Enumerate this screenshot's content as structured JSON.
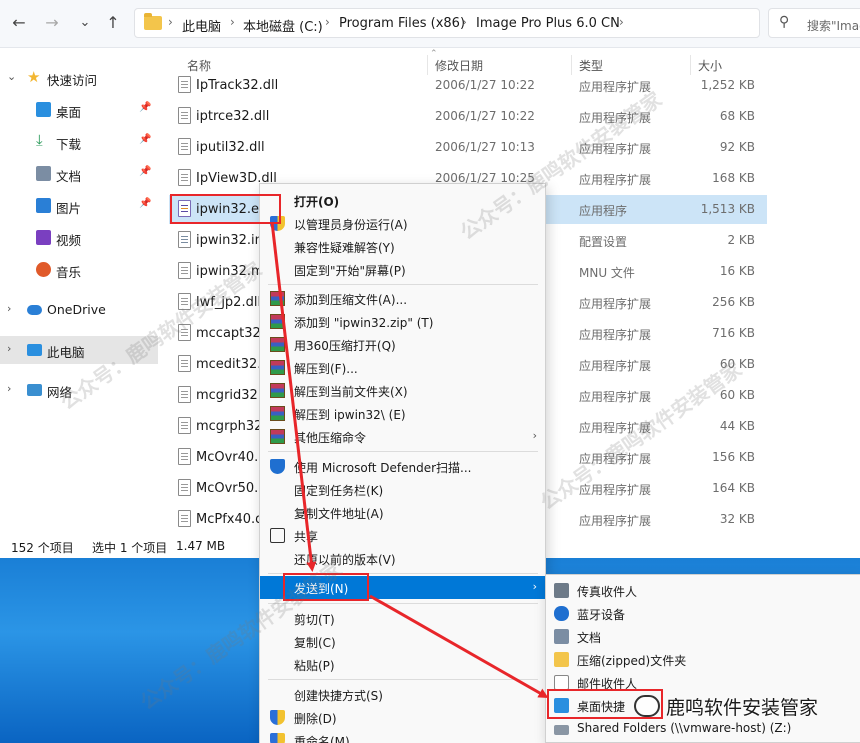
{
  "toolbar": {
    "back_icon": "←",
    "forward_icon": "→",
    "recent_icon": "⌄",
    "up_icon": "↑",
    "breadcrumb": [
      "此电脑",
      "本地磁盘 (C:)",
      "Program Files (x86)",
      "Image Pro Plus 6.0 CN"
    ],
    "search_placeholder": "搜索\"Imag"
  },
  "sidebar": {
    "items": [
      {
        "label": "快速访问",
        "icon": "star-icon"
      },
      {
        "label": "桌面",
        "icon": "desktop-icon"
      },
      {
        "label": "下载",
        "icon": "download-icon"
      },
      {
        "label": "文档",
        "icon": "document-icon"
      },
      {
        "label": "图片",
        "icon": "picture-icon"
      },
      {
        "label": "视频",
        "icon": "video-icon"
      },
      {
        "label": "音乐",
        "icon": "music-icon"
      },
      {
        "label": "OneDrive",
        "icon": "cloud-icon"
      },
      {
        "label": "此电脑",
        "icon": "computer-icon"
      },
      {
        "label": "网络",
        "icon": "network-icon"
      }
    ]
  },
  "columns": {
    "name": "名称",
    "date": "修改日期",
    "type": "类型",
    "size": "大小"
  },
  "files": [
    {
      "name": "IpTrack32.dll",
      "date": "2006/1/27 10:22",
      "type": "应用程序扩展",
      "size": "1,252 KB"
    },
    {
      "name": "iptrce32.dll",
      "date": "2006/1/27 10:22",
      "type": "应用程序扩展",
      "size": "68 KB"
    },
    {
      "name": "iputil32.dll",
      "date": "2006/1/27 10:13",
      "type": "应用程序扩展",
      "size": "92 KB"
    },
    {
      "name": "IpView3D.dll",
      "date": "2006/1/27 10:25",
      "type": "应用程序扩展",
      "size": "168 KB"
    },
    {
      "name": "ipwin32.exe",
      "date": "",
      "type": "应用程序",
      "size": "1,513 KB"
    },
    {
      "name": "ipwin32.ini",
      "date": "",
      "type": "配置设置",
      "size": "2 KB"
    },
    {
      "name": "ipwin32.mn",
      "date": "",
      "type": "MNU 文件",
      "size": "16 KB"
    },
    {
      "name": "lwf_jp2.dll",
      "date": "",
      "type": "应用程序扩展",
      "size": "256 KB"
    },
    {
      "name": "mccapt32.c",
      "date": "",
      "type": "应用程序扩展",
      "size": "716 KB"
    },
    {
      "name": "mcedit32.d",
      "date": "",
      "type": "应用程序扩展",
      "size": "60 KB"
    },
    {
      "name": "mcgrid32.d",
      "date": "",
      "type": "应用程序扩展",
      "size": "60 KB"
    },
    {
      "name": "mcgrph32.c",
      "date": "",
      "type": "应用程序扩展",
      "size": "44 KB"
    },
    {
      "name": "McOvr40.d",
      "date": "",
      "type": "应用程序扩展",
      "size": "156 KB"
    },
    {
      "name": "McOvr50.d",
      "date": "",
      "type": "应用程序扩展",
      "size": "164 KB"
    },
    {
      "name": "McPfx40.dl",
      "date": "",
      "type": "应用程序扩展",
      "size": "32 KB"
    }
  ],
  "status": {
    "count": "152 个项目",
    "selected": "选中 1 个项目",
    "size": "1.47 MB"
  },
  "context_menu": {
    "items": [
      {
        "label": "打开(O)",
        "icon": "",
        "bold": true
      },
      {
        "label": "以管理员身份运行(A)",
        "icon": "shield-icon"
      },
      {
        "label": "兼容性疑难解答(Y)",
        "icon": ""
      },
      {
        "label": "固定到\"开始\"屏幕(P)",
        "icon": ""
      },
      {
        "label": "添加到压缩文件(A)...",
        "icon": "rar-icon"
      },
      {
        "label": "添加到 \"ipwin32.zip\" (T)",
        "icon": "rar-icon"
      },
      {
        "label": "用360压缩打开(Q)",
        "icon": "rar-icon"
      },
      {
        "label": "解压到(F)...",
        "icon": "rar-icon"
      },
      {
        "label": "解压到当前文件夹(X)",
        "icon": "rar-icon"
      },
      {
        "label": "解压到 ipwin32\\ (E)",
        "icon": "rar-icon"
      },
      {
        "label": "其他压缩命令",
        "icon": "rar-icon",
        "arrow": "›"
      },
      {
        "label": "使用 Microsoft Defender扫描...",
        "icon": "defender-icon"
      },
      {
        "label": "固定到任务栏(K)",
        "icon": ""
      },
      {
        "label": "复制文件地址(A)",
        "icon": ""
      },
      {
        "label": "共享",
        "icon": "share-icon"
      },
      {
        "label": "还原以前的版本(V)",
        "icon": ""
      },
      {
        "label": "发送到(N)",
        "icon": "",
        "arrow": "›"
      },
      {
        "label": "剪切(T)",
        "icon": ""
      },
      {
        "label": "复制(C)",
        "icon": ""
      },
      {
        "label": "粘贴(P)",
        "icon": ""
      },
      {
        "label": "创建快捷方式(S)",
        "icon": ""
      },
      {
        "label": "删除(D)",
        "icon": "shield-icon"
      },
      {
        "label": "重命名(M)",
        "icon": "shield-icon"
      }
    ]
  },
  "send_to": {
    "items": [
      {
        "label": "传真收件人",
        "icon": "fax-icon"
      },
      {
        "label": "蓝牙设备",
        "icon": "bluetooth-icon"
      },
      {
        "label": "文档",
        "icon": "document-icon"
      },
      {
        "label": "压缩(zipped)文件夹",
        "icon": "zip-folder-icon"
      },
      {
        "label": "邮件收件人",
        "icon": "mail-icon"
      },
      {
        "label": "桌面快捷",
        "icon": "desktop-icon"
      },
      {
        "label": "Shared Folders (\\\\vmware-host) (Z:)",
        "icon": "network-drive-icon"
      }
    ]
  },
  "watermark": {
    "text": "鹿鸣软件安装管家",
    "prefix": "公众号：",
    "brand": "鹿鸣软件安装管家"
  },
  "colors": {
    "highlight": "#0078d7",
    "selection": "#cce4f7",
    "annotation": "#e8262a"
  }
}
